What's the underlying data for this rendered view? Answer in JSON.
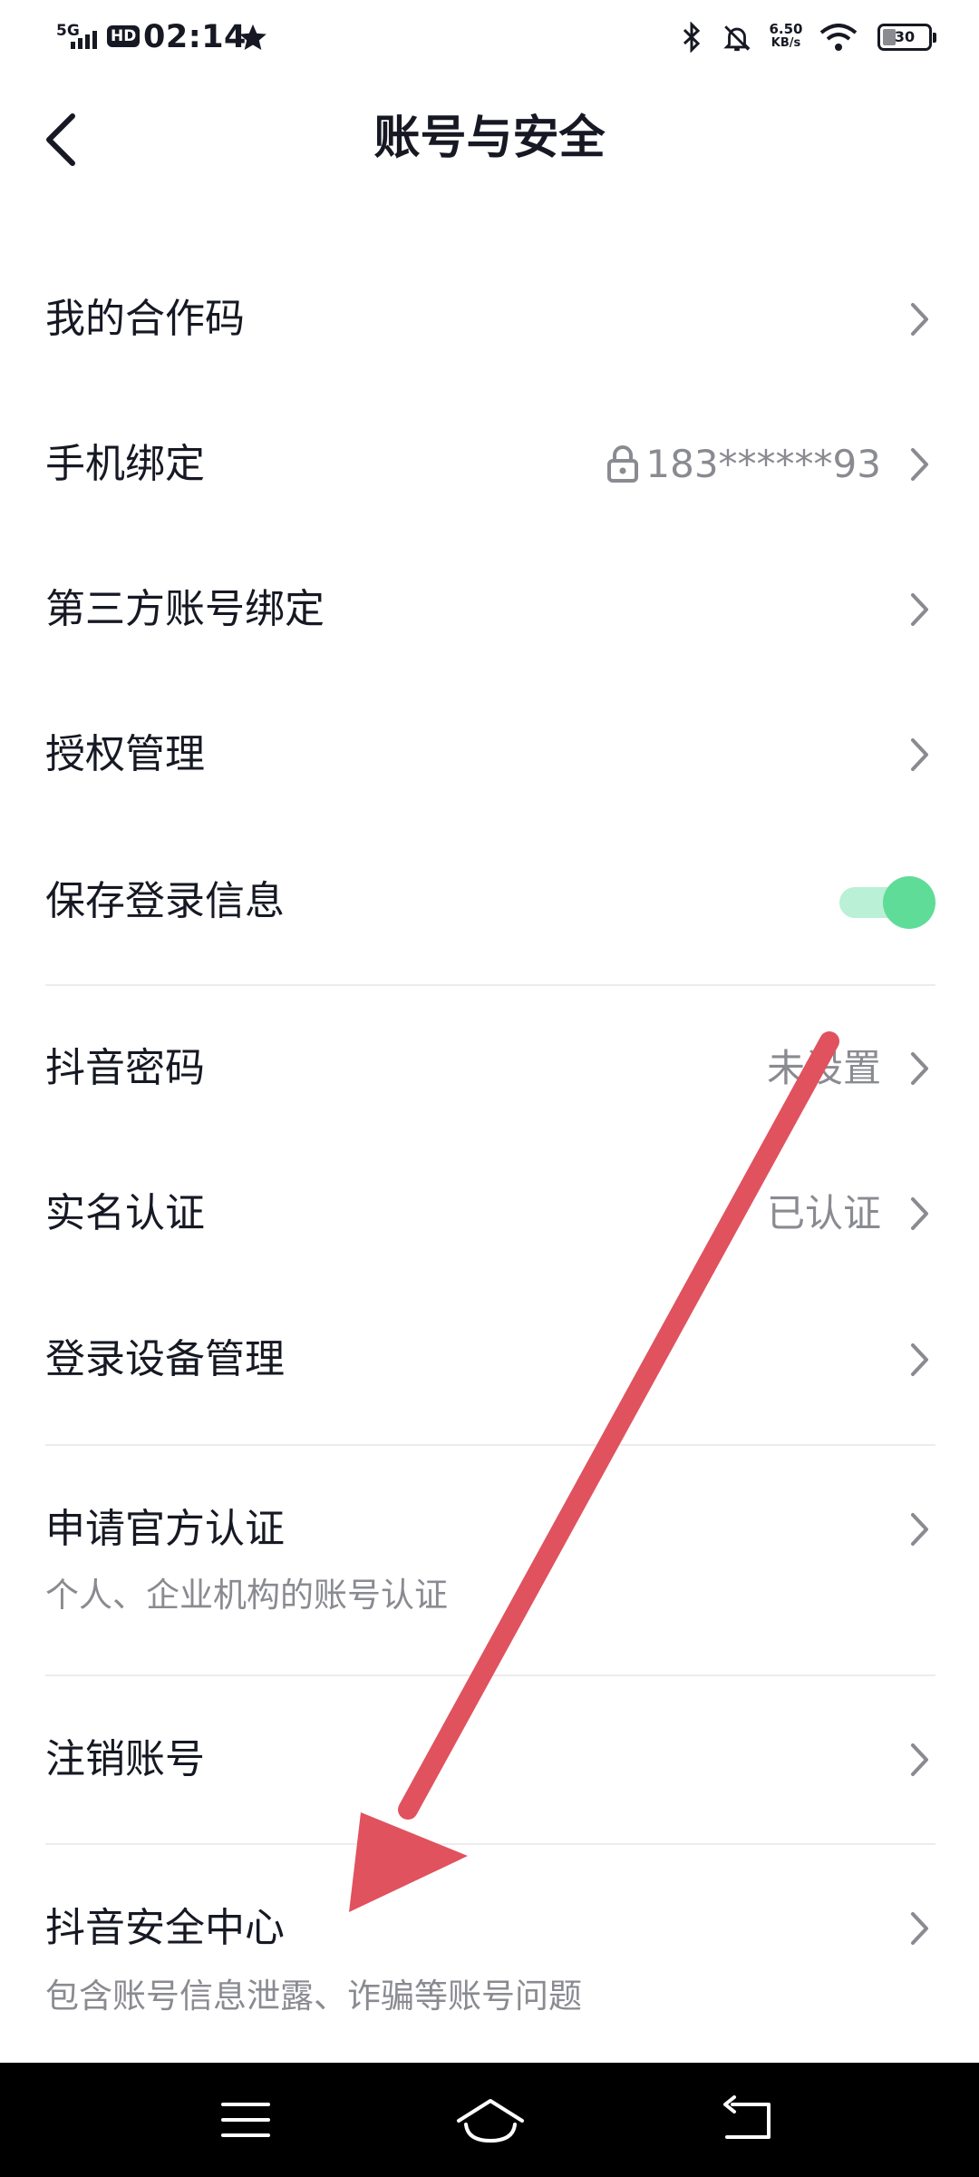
{
  "status_bar": {
    "network": "5G",
    "hd": "HD",
    "time": "02:14",
    "speed_value": "6.50",
    "speed_unit": "KB/s",
    "battery": "30"
  },
  "header": {
    "title": "账号与安全"
  },
  "rows": {
    "coop_code": {
      "label": "我的合作码"
    },
    "phone": {
      "label": "手机绑定",
      "value": "183******93"
    },
    "third_party": {
      "label": "第三方账号绑定"
    },
    "auth_mgmt": {
      "label": "授权管理"
    },
    "save_login": {
      "label": "保存登录信息",
      "toggle_on": true
    },
    "password": {
      "label": "抖音密码",
      "value": "未设置"
    },
    "real_name": {
      "label": "实名认证",
      "value": "已认证"
    },
    "devices": {
      "label": "登录设备管理"
    },
    "official": {
      "label": "申请官方认证",
      "sub": "个人、企业机构的账号认证"
    },
    "cancel": {
      "label": "注销账号"
    },
    "security": {
      "label": "抖音安全中心",
      "sub": "包含账号信息泄露、诈骗等账号问题"
    }
  },
  "colors": {
    "text_primary": "#161823",
    "text_secondary": "#8a8b91",
    "toggle_on": "#5fdc98",
    "annotation_arrow": "#e0525e"
  },
  "icons": {
    "back": "back-arrow-icon",
    "chevron": "chevron-right-icon",
    "lock": "lock-icon"
  }
}
